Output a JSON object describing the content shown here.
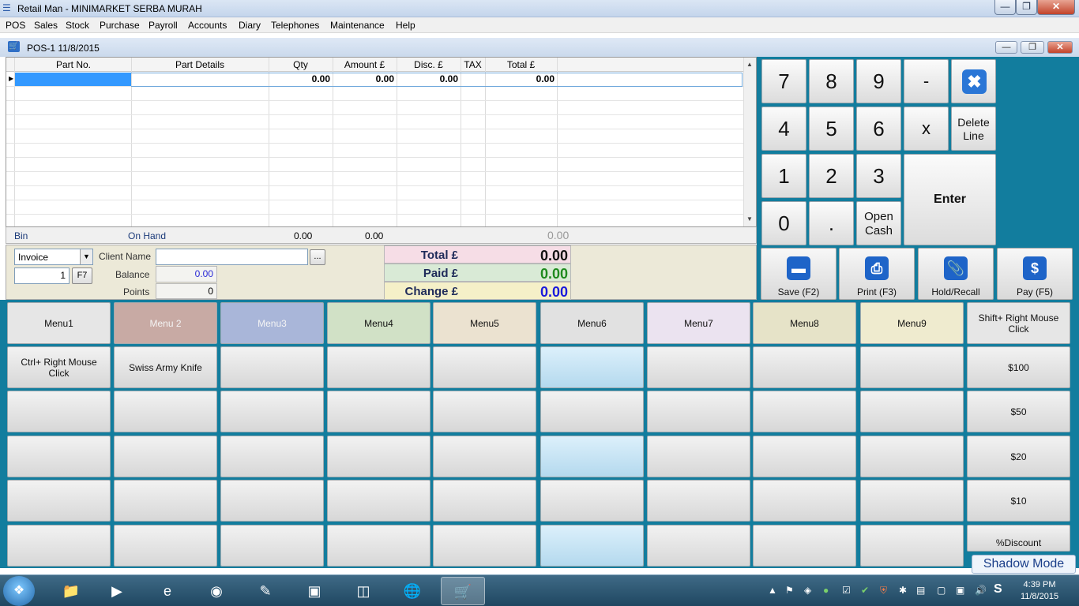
{
  "window": {
    "title": "Retail Man - MINIMARKET SERBA MURAH"
  },
  "menubar": [
    "POS",
    "Sales",
    "Stock",
    "Purchase",
    "Payroll",
    "Accounts",
    "Diary",
    "Telephones",
    "Maintenance",
    "Help"
  ],
  "mdi": {
    "title": "POS-1  11/8/2015"
  },
  "grid": {
    "columns": [
      "Part No.",
      "Part Details",
      "Qty",
      "Amount £",
      "Disc. £",
      "TAX",
      "Total £"
    ],
    "row": {
      "qty": "0.00",
      "amount": "0.00",
      "disc": "0.00",
      "total": "0.00"
    }
  },
  "summary": {
    "bin_label": "Bin",
    "onhand_label": "On Hand",
    "qty": "0.00",
    "amount": "0.00",
    "total": "0.00"
  },
  "client": {
    "doc_type": "Invoice",
    "doc_number": "1",
    "f7_label": "F7",
    "client_name_label": "Client Name",
    "client_name_value": "",
    "browse_label": "...",
    "balance_label": "Balance",
    "balance_value": "0.00",
    "points_label": "Points",
    "points_value": "0"
  },
  "totals": {
    "total_label": "Total £",
    "total_value": "0.00",
    "paid_label": "Paid £",
    "paid_value": "0.00",
    "change_label": "Change £",
    "change_value": "0.00",
    "colors": {
      "total_bg": "#f6dde6",
      "paid_bg": "#d9ead6",
      "change_bg": "#f5f0c8",
      "paid_fg": "#1f8a1f",
      "change_fg": "#1a1adc"
    }
  },
  "keypad": {
    "keys": [
      "7",
      "8",
      "9",
      "-",
      "4",
      "5",
      "6",
      "x",
      "1",
      "2",
      "3",
      "0",
      "."
    ],
    "delete_line": "Delete Line",
    "open_cash": "Open Cash",
    "enter": "Enter"
  },
  "function_buttons": [
    {
      "label": "Save (F2)",
      "icon": "card-icon"
    },
    {
      "label": "Print (F3)",
      "icon": "printer-icon"
    },
    {
      "label": "Hold/Recall",
      "icon": "paperclip-icon"
    },
    {
      "label": "Pay (F5)",
      "icon": "dollar-icon"
    }
  ],
  "menu_buttons": {
    "row1": [
      "Menu1",
      "Menu 2",
      "Menu3",
      "Menu4",
      "Menu5",
      "Menu6",
      "Menu7",
      "Menu8",
      "Menu9",
      "Shift+ Right Mouse Click"
    ],
    "row2": [
      "Ctrl+ Right Mouse Click",
      "Swiss Army Knife",
      "",
      "",
      "",
      "",
      "",
      "",
      "",
      "$100"
    ],
    "row3": [
      "",
      "",
      "",
      "",
      "",
      "",
      "",
      "",
      "",
      "$50"
    ],
    "row4": [
      "",
      "",
      "",
      "",
      "",
      "",
      "",
      "",
      "",
      "$20"
    ],
    "row5": [
      "",
      "",
      "",
      "",
      "",
      "",
      "",
      "",
      "",
      "$10"
    ],
    "row6": [
      "",
      "",
      "",
      "",
      "",
      "",
      "",
      "",
      "",
      "%Discount"
    ],
    "row1_colors": [
      "#e6e6e6",
      "#c8aaa4",
      "#a9b6d9",
      "#d1e1c6",
      "#ebe2d0",
      "#e1e1e1",
      "#ebe3f0",
      "#e6e3c8",
      "#efebcf",
      "#e6e6e6"
    ]
  },
  "shadow_mode": "Shadow Mode",
  "taskbar": {
    "apps": [
      "explorer-icon",
      "media-player-icon",
      "ie-icon",
      "firefox-icon",
      "notepad-icon",
      "window-app-icon",
      "writer-icon",
      "globe-icon",
      "cart-icon"
    ],
    "clock_time": "4:39 PM",
    "clock_date": "11/8/2015"
  }
}
